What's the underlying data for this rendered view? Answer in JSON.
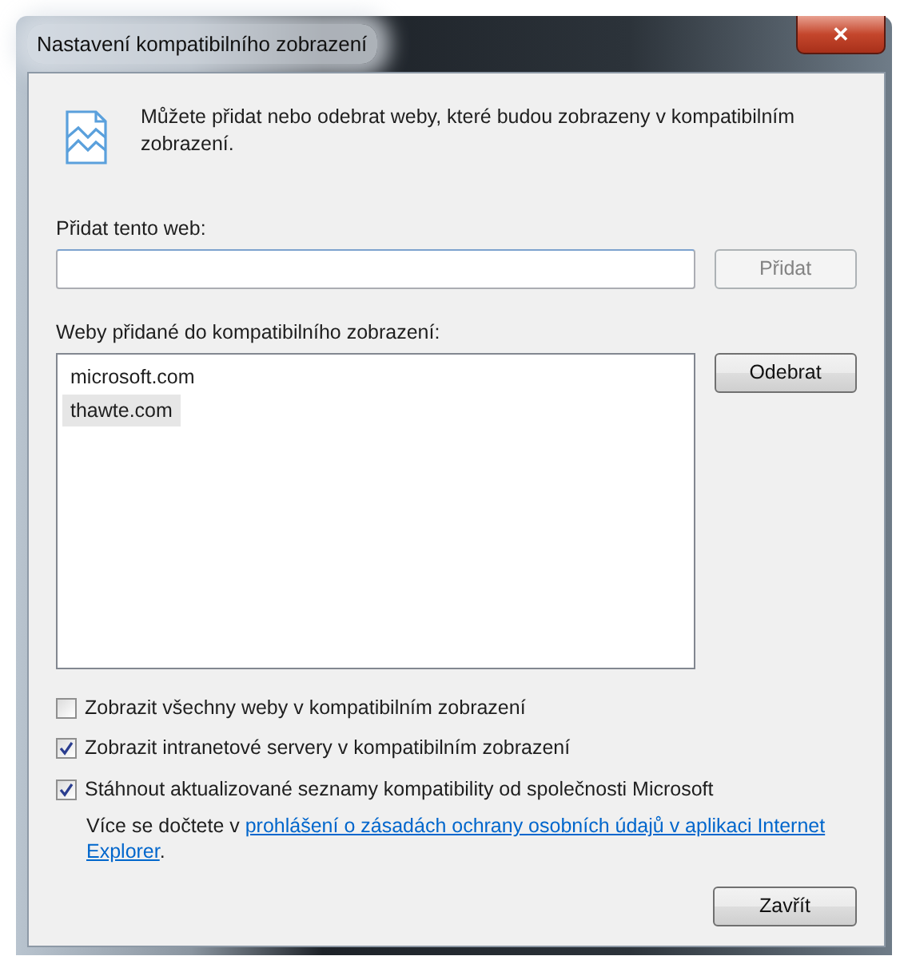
{
  "window": {
    "title": "Nastavení kompatibilního zobrazení",
    "close": "✕"
  },
  "intro": "Můžete přidat nebo odebrat weby, které budou zobrazeny v kompatibilním zobrazení.",
  "add_site": {
    "label": "Přidat tento web:",
    "button": {
      "label": "Přidat",
      "disabled": true
    }
  },
  "sites": {
    "label": "Weby přidané do kompatibilního zobrazení:",
    "items": [
      {
        "text": "microsoft.com",
        "selected": false
      },
      {
        "text": "thawte.com",
        "selected": true
      }
    ],
    "button": {
      "label": "Odebrat",
      "disabled": false
    }
  },
  "options": [
    {
      "label": "Zobrazit všechny weby v kompatibilním zobrazení",
      "checked": false
    },
    {
      "label": "Zobrazit intranetové servery v kompatibilním zobrazení",
      "checked": true
    },
    {
      "label": "Stáhnout aktualizované seznamy kompatibility od společnosti Microsoft",
      "checked": true
    }
  ],
  "info": {
    "text": "Více se dočtete v",
    "link_lines": [
      "prohlášení o zásadách ochrany osobních údajů v aplikaci Internet",
      "Explorer"
    ],
    "end": "."
  },
  "buttons": [
    {
      "label": "Zavřít",
      "disabled": false
    }
  ]
}
